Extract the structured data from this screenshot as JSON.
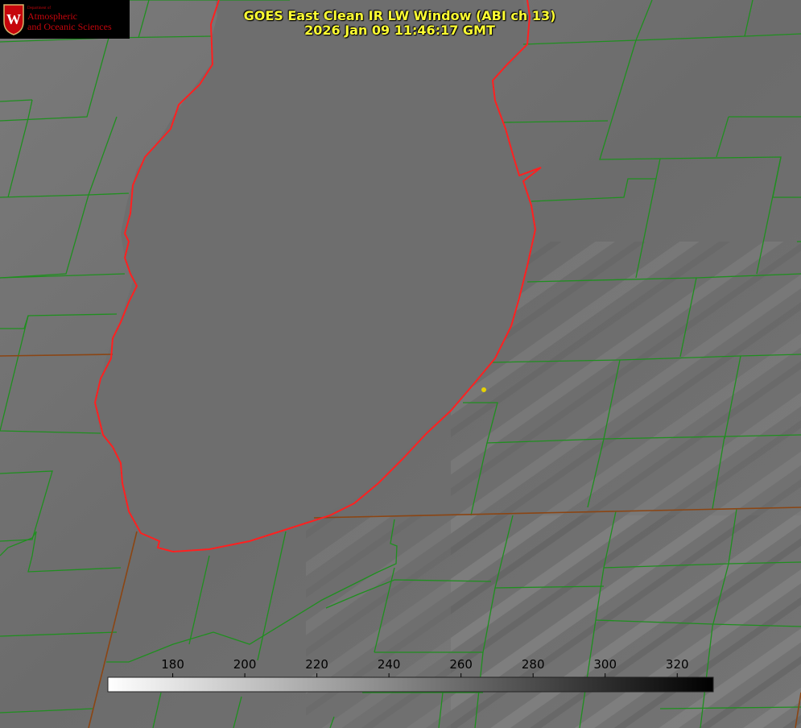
{
  "title": {
    "line1": "GOES East Clean IR LW Window (ABI ch 13)",
    "line2": "2026 Jan 09 11:46:17 GMT"
  },
  "logo": {
    "department": "Department of",
    "line1": "Atmospheric",
    "line2": "and Oceanic Sciences",
    "crest_letter": "W"
  },
  "colorbar": {
    "ticks": [
      "180",
      "200",
      "220",
      "240",
      "260",
      "280",
      "300",
      "320"
    ],
    "min_value": 162,
    "max_value": 330,
    "gradient": [
      "#ffffff",
      "#000000"
    ]
  },
  "colors": {
    "county_lines": "#1f8f1f",
    "state_lines": "#8b4513",
    "lake_shore": "#ff2020",
    "marker": "#e6d200",
    "title": "#ffff33",
    "logo": "#c5050c"
  }
}
